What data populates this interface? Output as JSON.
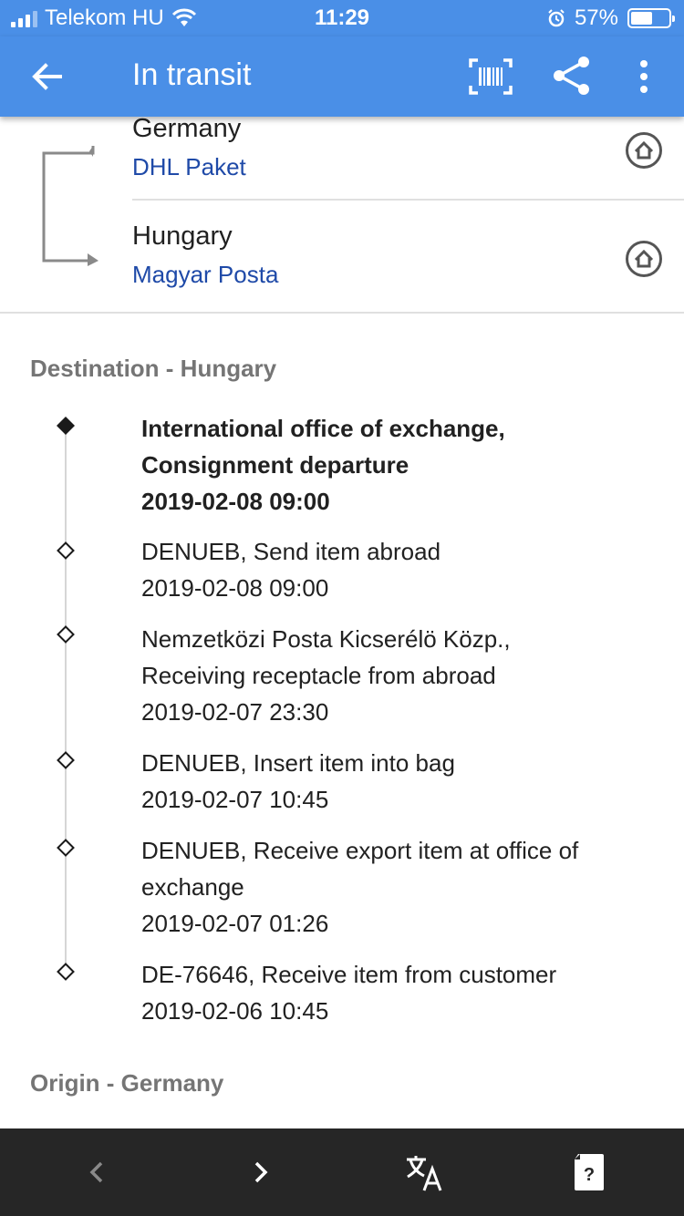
{
  "status_bar": {
    "carrier": "Telekom HU",
    "time": "11:29",
    "battery_percent": "57%",
    "battery_level": 0.57,
    "icons": [
      "signal-icon",
      "wifi-icon",
      "alarm-icon",
      "battery-icon"
    ]
  },
  "app_bar": {
    "title": "In transit",
    "icons": [
      "back-arrow-icon",
      "barcode-icon",
      "share-icon",
      "more-vert-icon"
    ]
  },
  "route": {
    "stops": [
      {
        "country": "Germany",
        "carrier": "DHL Paket",
        "icon": "home-icon"
      },
      {
        "country": "Hungary",
        "carrier": "Magyar Posta",
        "icon": "home-icon"
      }
    ]
  },
  "destination_section": {
    "title": "Destination - Hungary"
  },
  "events": [
    {
      "line1": "International office of exchange,",
      "line2": "Consignment departure",
      "time": "2019-02-08 09:00",
      "active": true
    },
    {
      "line1": "DENUEB, Send item abroad",
      "line2": "",
      "time": "2019-02-08 09:00",
      "active": false
    },
    {
      "line1": "Nemzetközi Posta Kicserélö Közp.,",
      "line2": "Receiving receptacle from abroad",
      "time": "2019-02-07 23:30",
      "active": false
    },
    {
      "line1": "DENUEB, Insert item into bag",
      "line2": "",
      "time": "2019-02-07 10:45",
      "active": false
    },
    {
      "line1": "DENUEB, Receive export item at office of",
      "line2": "exchange",
      "time": "2019-02-07 01:26",
      "active": false
    },
    {
      "line1": "DE-76646, Receive item from customer",
      "line2": "",
      "time": "2019-02-06 10:45",
      "active": false
    }
  ],
  "origin_section": {
    "title": "Origin - Germany"
  },
  "bottom_bar": {
    "icons": [
      "chevron-left-icon",
      "chevron-right-icon",
      "translate-icon",
      "help-card-icon"
    ]
  },
  "colors": {
    "primary": "#4a8fe7",
    "link": "#1f4aa8",
    "section_title": "#757575",
    "bottom_bar": "#262626"
  }
}
